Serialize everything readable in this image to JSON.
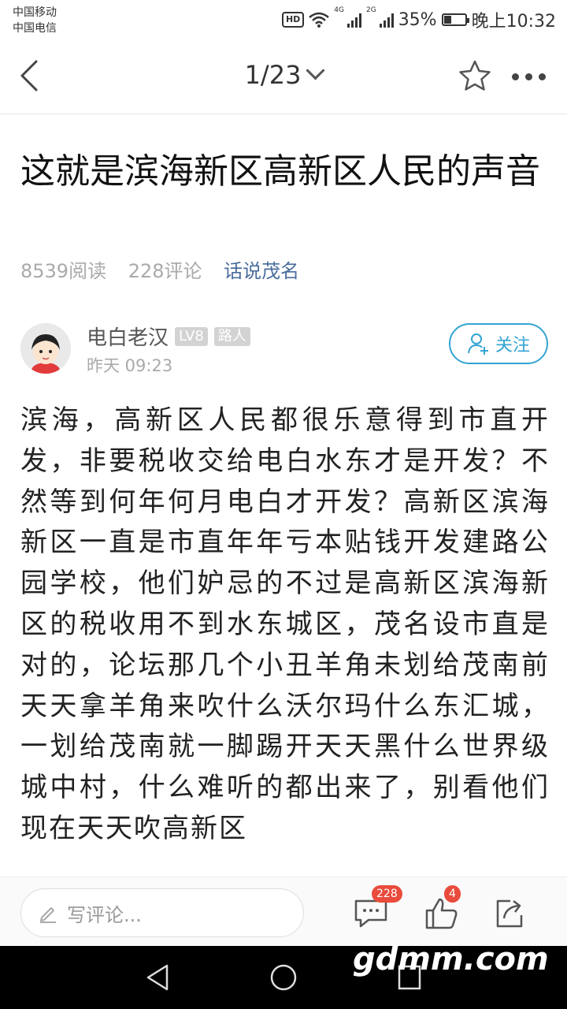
{
  "status_bar": {
    "carrier1": "中国移动",
    "carrier2": "中国电信",
    "hd": "HD",
    "net1": "4G",
    "net2": "2G",
    "battery": "35%",
    "time": "晚上10:32"
  },
  "nav": {
    "page_indicator": "1/23"
  },
  "article": {
    "title": "这就是滨海新区高新区人民的声音",
    "reads": "8539阅读",
    "comments": "228评论",
    "forum": "话说茂名",
    "author": {
      "name": "电白老汉",
      "level": "LV8",
      "role": "路人",
      "time": "昨天 09:23",
      "follow_label": "关注"
    },
    "body": "滨海，高新区人民都很乐意得到市直开发，非要税收交给电白水东才是开发？不然等到何年何月电白才开发？高新区滨海新区一直是市直年年亏本贴钱开发建路公园学校，他们妒忌的不过是高新区滨海新区的税收用不到水东城区，茂名设市直是对的，论坛那几个小丑羊角未划给茂南前天天拿羊角来吹什么沃尔玛什么东汇城，一划给茂南就一脚踢开天天黑什么世界级城中村，什么难听的都出来了，别看他们现在天天吹高新区"
  },
  "bottom_bar": {
    "comment_placeholder": "写评论...",
    "comment_count": "228",
    "like_count": "4"
  },
  "watermark": "gdmm.com",
  "colors": {
    "accent": "#33a4d3",
    "forum_link": "#4a6d9c",
    "badge": "#e94b3c"
  }
}
